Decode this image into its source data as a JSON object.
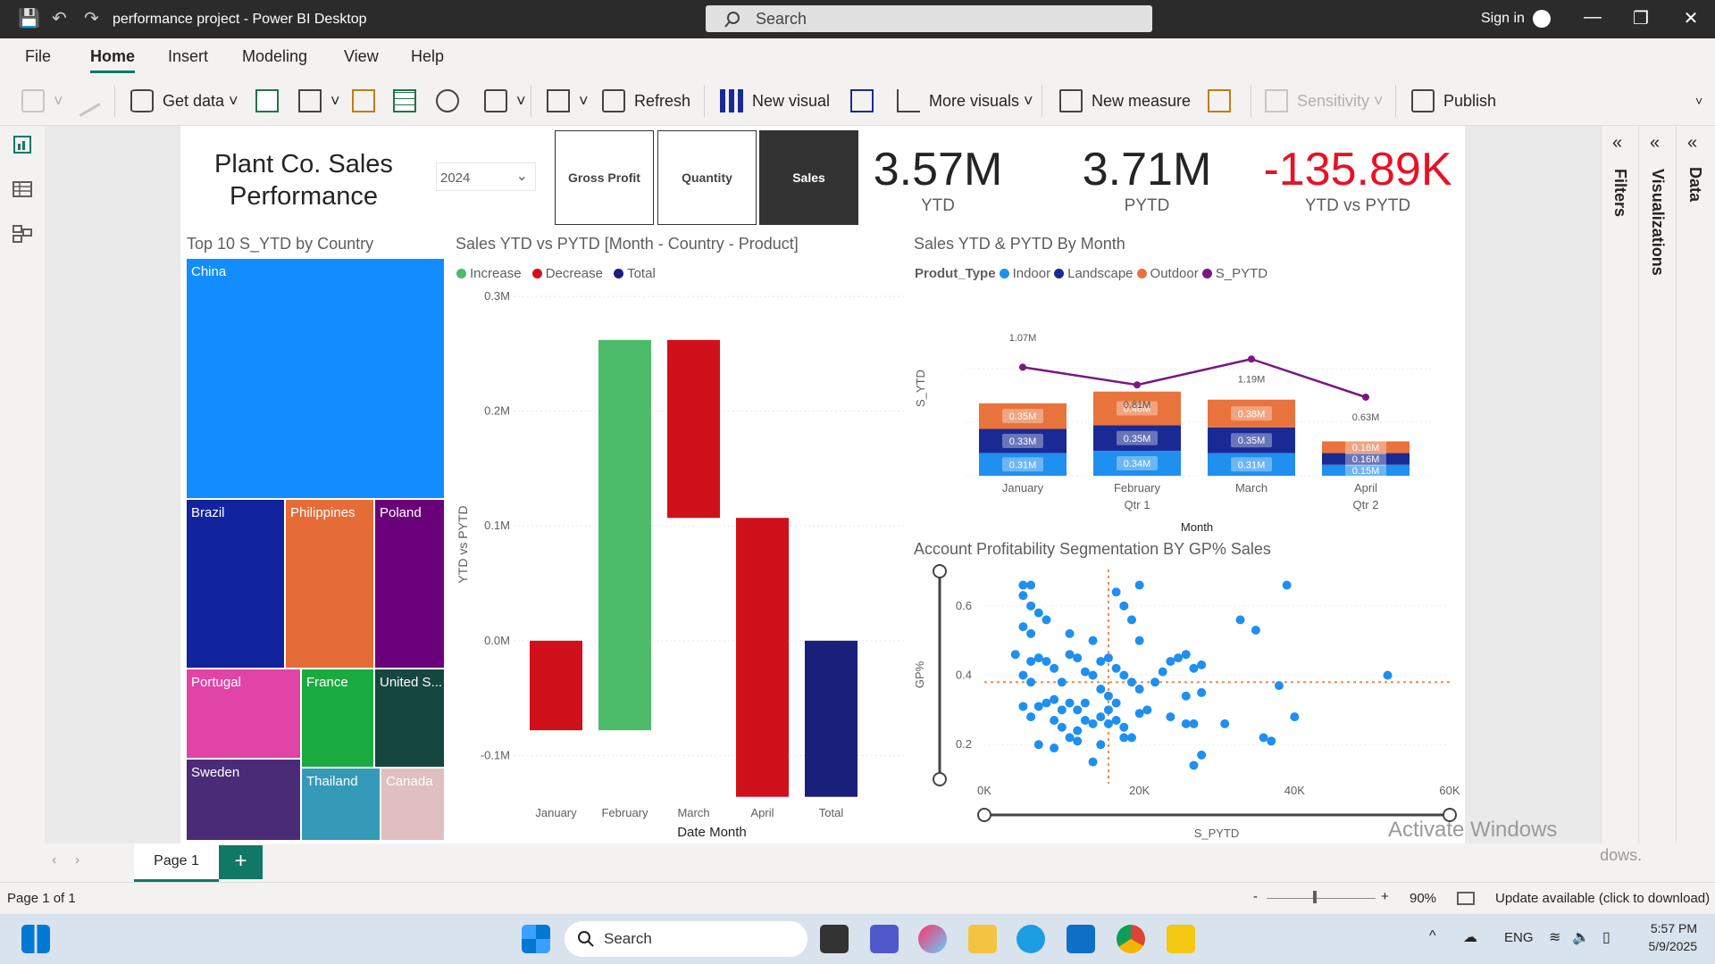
{
  "window": {
    "title": "performance project - Power BI Desktop",
    "search_placeholder": "Search",
    "signin": "Sign in"
  },
  "menu": [
    "File",
    "Home",
    "Insert",
    "Modeling",
    "View",
    "Help"
  ],
  "ribbon": {
    "get_data": "Get data",
    "refresh": "Refresh",
    "new_visual": "New visual",
    "more_visuals": "More visuals",
    "new_measure": "New measure",
    "sensitivity": "Sensitivity",
    "publish": "Publish"
  },
  "panes": {
    "filters": "Filters",
    "visualizations": "Visualizations",
    "data": "Data"
  },
  "report": {
    "title": "Plant Co. Sales Performance",
    "year": "2024",
    "toggles": [
      "Gross Profit",
      "Quantity",
      "Sales"
    ],
    "kpis": [
      {
        "value": "3.57M",
        "label": "YTD",
        "color": "#252423"
      },
      {
        "value": "3.71M",
        "label": "PYTD",
        "color": "#252423"
      },
      {
        "value": "-135.89K",
        "label": "YTD vs PYTD",
        "color": "#e81123"
      }
    ]
  },
  "treemap": {
    "title": "Top 10 S_YTD by Country",
    "items": [
      "China",
      "Brazil",
      "Philippines",
      "Poland",
      "Portugal",
      "France",
      "United S...",
      "Sweden",
      "Thailand",
      "Canada"
    ]
  },
  "chart_data": [
    {
      "type": "bar",
      "subtype": "waterfall",
      "title": "Sales YTD vs PYTD [Month - Country - Product]",
      "legend": [
        "Increase",
        "Decrease",
        "Total"
      ],
      "colors": {
        "Increase": "#4cbb6a",
        "Decrease": "#d0111b",
        "Total": "#1a1f7c"
      },
      "categories": [
        "January",
        "February",
        "March",
        "April",
        "Total"
      ],
      "deltas": [
        -0.078,
        0.34,
        -0.155,
        -0.243,
        -0.136
      ],
      "ylabel": "YTD vs PYTD",
      "xlabel": "Date Month",
      "yticks": [
        "0.3M",
        "0.2M",
        "0.1M",
        "0.0M",
        "-0.1M"
      ],
      "ylim": [
        -0.13,
        0.3
      ]
    },
    {
      "type": "bar",
      "subtype": "stacked with line",
      "title": "Sales YTD & PYTD By Month",
      "legend_title": "Produt_Type",
      "series": [
        {
          "name": "Indoor",
          "color": "#1f8ff0",
          "values": [
            0.31,
            0.34,
            0.31,
            0.15
          ]
        },
        {
          "name": "Landscape",
          "color": "#1a2a94",
          "values": [
            0.33,
            0.35,
            0.35,
            0.16
          ]
        },
        {
          "name": "Outdoor",
          "color": "#e8733c",
          "values": [
            0.35,
            0.46,
            0.38,
            0.16
          ]
        }
      ],
      "line": {
        "name": "S_PYTD",
        "color": "#7a1780",
        "values": [
          1.07,
          0.81,
          1.19,
          0.63
        ]
      },
      "categories": [
        "January",
        "February",
        "March",
        "April"
      ],
      "quarters": [
        "Qtr 1",
        "Qtr 2"
      ],
      "ylabel": "S_YTD",
      "xlabel": "Month"
    },
    {
      "type": "scatter",
      "title": "Account Profitability Segmentation BY GP% Sales",
      "xlabel": "S_PYTD",
      "ylabel": "GP%",
      "xticks": [
        "0K",
        "20K",
        "40K",
        "60K"
      ],
      "yticks": [
        "0.6",
        "0.4",
        "0.2"
      ],
      "xlim": [
        0,
        60
      ],
      "ylim": [
        0.1,
        0.7
      ],
      "ref_x": 16,
      "ref_y": 0.38,
      "points": [
        [
          5,
          0.66
        ],
        [
          6,
          0.66
        ],
        [
          5,
          0.63
        ],
        [
          6,
          0.6
        ],
        [
          7,
          0.58
        ],
        [
          5,
          0.54
        ],
        [
          6,
          0.52
        ],
        [
          11,
          0.52
        ],
        [
          8,
          0.56
        ],
        [
          14,
          0.5
        ],
        [
          17,
          0.64
        ],
        [
          18,
          0.6
        ],
        [
          19,
          0.56
        ],
        [
          20,
          0.66
        ],
        [
          20,
          0.5
        ],
        [
          4,
          0.46
        ],
        [
          6,
          0.44
        ],
        [
          7,
          0.45
        ],
        [
          8,
          0.44
        ],
        [
          5,
          0.4
        ],
        [
          6,
          0.38
        ],
        [
          9,
          0.42
        ],
        [
          11,
          0.46
        ],
        [
          12,
          0.45
        ],
        [
          10,
          0.38
        ],
        [
          13,
          0.41
        ],
        [
          14,
          0.4
        ],
        [
          15,
          0.44
        ],
        [
          16,
          0.45
        ],
        [
          17,
          0.42
        ],
        [
          18,
          0.4
        ],
        [
          19,
          0.38
        ],
        [
          20,
          0.36
        ],
        [
          15,
          0.36
        ],
        [
          16,
          0.34
        ],
        [
          13,
          0.32
        ],
        [
          12,
          0.3
        ],
        [
          11,
          0.32
        ],
        [
          10,
          0.3
        ],
        [
          9,
          0.33
        ],
        [
          8,
          0.32
        ],
        [
          7,
          0.31
        ],
        [
          6,
          0.28
        ],
        [
          5,
          0.31
        ],
        [
          9,
          0.27
        ],
        [
          10,
          0.25
        ],
        [
          11,
          0.22
        ],
        [
          12,
          0.24
        ],
        [
          13,
          0.27
        ],
        [
          14,
          0.26
        ],
        [
          15,
          0.28
        ],
        [
          16,
          0.3
        ],
        [
          17,
          0.27
        ],
        [
          18,
          0.25
        ],
        [
          19,
          0.22
        ],
        [
          20,
          0.29
        ],
        [
          21,
          0.3
        ],
        [
          22,
          0.38
        ],
        [
          23,
          0.41
        ],
        [
          24,
          0.44
        ],
        [
          25,
          0.45
        ],
        [
          26,
          0.46
        ],
        [
          27,
          0.42
        ],
        [
          28,
          0.43
        ],
        [
          26,
          0.34
        ],
        [
          28,
          0.35
        ],
        [
          24,
          0.28
        ],
        [
          26,
          0.26
        ],
        [
          27,
          0.26
        ],
        [
          31,
          0.26
        ],
        [
          28,
          0.17
        ],
        [
          27,
          0.14
        ],
        [
          9,
          0.19
        ],
        [
          7,
          0.2
        ],
        [
          14,
          0.15
        ],
        [
          36,
          0.22
        ],
        [
          37,
          0.21
        ],
        [
          33,
          0.56
        ],
        [
          35,
          0.53
        ],
        [
          38,
          0.37
        ],
        [
          40,
          0.28
        ],
        [
          39,
          0.66
        ],
        [
          52,
          0.4
        ],
        [
          18,
          0.22
        ],
        [
          15,
          0.2
        ],
        [
          12,
          0.21
        ],
        [
          16,
          0.26
        ],
        [
          17,
          0.32
        ]
      ]
    }
  ],
  "page": {
    "tab": "Page 1",
    "status": "Page 1 of 1",
    "zoom": "90%",
    "update": "Update available (click to download)"
  },
  "watermark": {
    "line1": "Activate Windows",
    "line2": "Go to Settings to activate Windows."
  },
  "taskbar": {
    "search": "Search",
    "lang": "ENG",
    "time": "5:57 PM",
    "date": "5/9/2025"
  }
}
